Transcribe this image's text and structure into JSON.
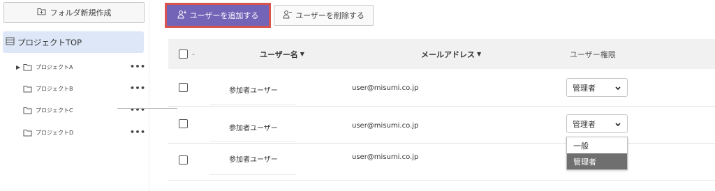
{
  "sidebar": {
    "new_folder_label": "フォルダ新規作成",
    "root_label": "プロジェクトTOP",
    "items": [
      {
        "label": "プロジェクトA",
        "more": "•••"
      },
      {
        "label": "プロジェクトB",
        "more": "•••"
      },
      {
        "label": "プロジェクトC",
        "more": "•••"
      },
      {
        "label": "プロジェクトD",
        "more": "•••"
      }
    ]
  },
  "toolbar": {
    "add_user_label": "ユーザーを追加する",
    "delete_user_label": "ユーザーを削除する"
  },
  "table": {
    "select_all_suffix": "-",
    "headers": {
      "username": "ユーザー名",
      "email": "メールアドレス",
      "permission": "ユーザー権限"
    },
    "rows": [
      {
        "name": "参加者ユーザー",
        "email": "user@misumi.co.jp",
        "permission": "管理者"
      },
      {
        "name": "参加者ユーザー",
        "email": "user@misumi.co.jp",
        "permission": "管理者"
      },
      {
        "name": "参加者ユーザー",
        "email": "user@misumi.co.jp",
        "permission": ""
      }
    ]
  },
  "dropdown": {
    "options": [
      "一般",
      "管理者"
    ],
    "selected": "管理者"
  },
  "colors": {
    "accent": "#7464b8",
    "highlight_border": "#d9534f",
    "selected_tree": "#dde7f7",
    "selected_option": "#6f6f6f"
  },
  "icons": {
    "new_folder": "folder-plus-icon",
    "root": "list-icon",
    "folder": "folder-icon",
    "add_user": "user-plus-icon",
    "delete_user": "user-minus-icon",
    "sort": "sort-down-icon",
    "dropdown": "chevron-down-icon"
  }
}
